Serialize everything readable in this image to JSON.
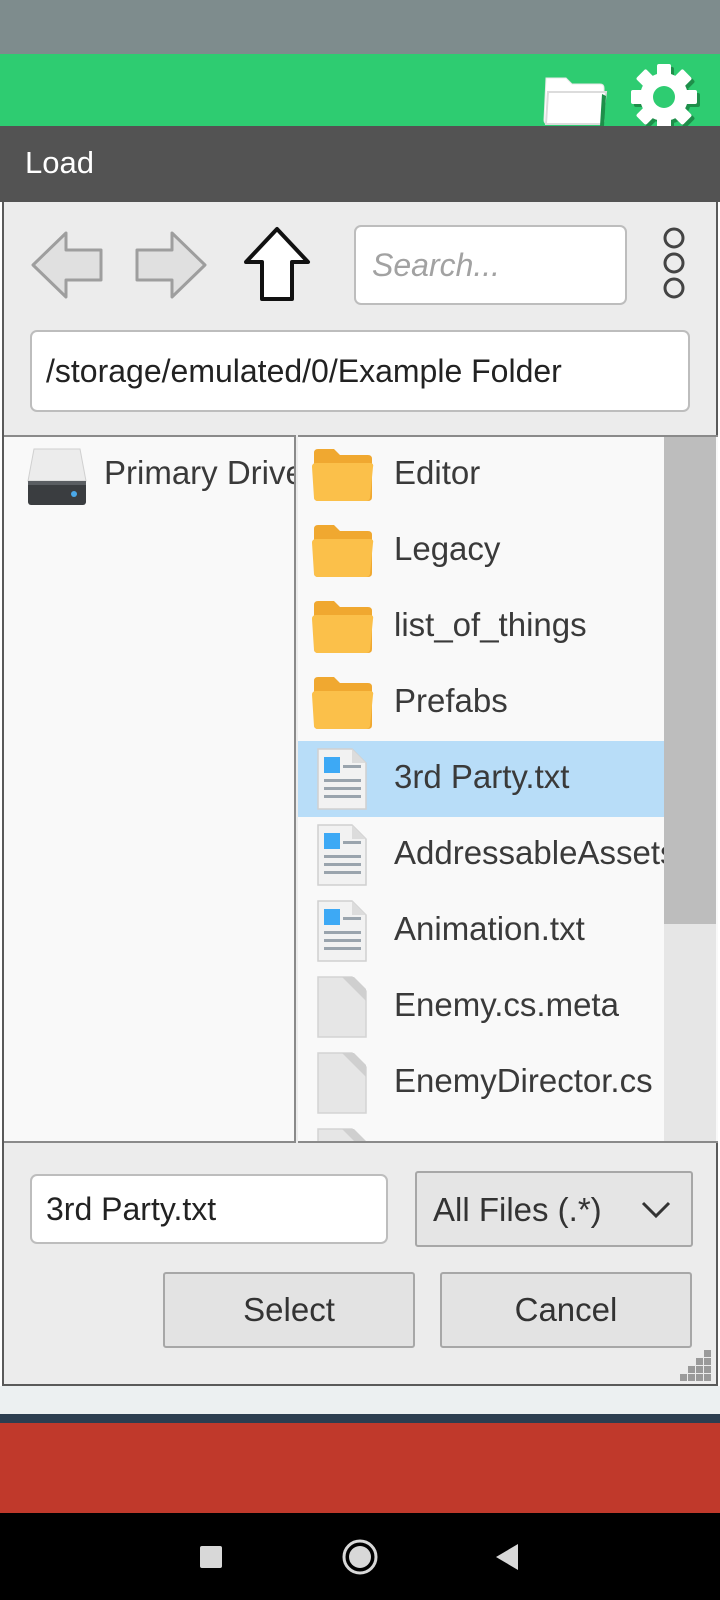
{
  "colors": {
    "status_bar": "#7e8c8d",
    "app_bar": "#2ecc71",
    "title_bar": "#535353",
    "selection": "#b8ddf8",
    "folder": "#f7b637",
    "bottom_red": "#c0392b",
    "nav_bar": "#000000"
  },
  "app_bar": {
    "icons": [
      "folder-icon",
      "gear-icon"
    ]
  },
  "dialog": {
    "title": "Load",
    "toolbar": {
      "icons": [
        "back-arrow-icon",
        "forward-arrow-icon",
        "up-arrow-icon",
        "more-options-icon"
      ],
      "search_placeholder": "Search..."
    },
    "path": "/storage/emulated/0/Example Folder",
    "drives": [
      {
        "label": "Primary Drive",
        "icon": "hard-drive-icon"
      }
    ],
    "files": [
      {
        "name": "Editor",
        "type": "folder"
      },
      {
        "name": "Legacy",
        "type": "folder"
      },
      {
        "name": "list_of_things",
        "type": "folder"
      },
      {
        "name": "Prefabs",
        "type": "folder"
      },
      {
        "name": "3rd Party.txt",
        "type": "text",
        "selected": true
      },
      {
        "name": "AddressableAssets.txt",
        "type": "text"
      },
      {
        "name": "Animation.txt",
        "type": "text"
      },
      {
        "name": "Enemy.cs.meta",
        "type": "generic"
      },
      {
        "name": "EnemyDirector.cs",
        "type": "generic"
      },
      {
        "name": "",
        "type": "generic"
      }
    ],
    "scroll_position_fraction": 0.0,
    "scroll_visible_fraction": 0.69,
    "filename_value": "3rd Party.txt",
    "filter_selected": "All Files (.*)",
    "select_label": "Select",
    "cancel_label": "Cancel"
  },
  "system_nav": {
    "icons": [
      "recents-square-icon",
      "home-circle-icon",
      "back-triangle-icon"
    ]
  }
}
